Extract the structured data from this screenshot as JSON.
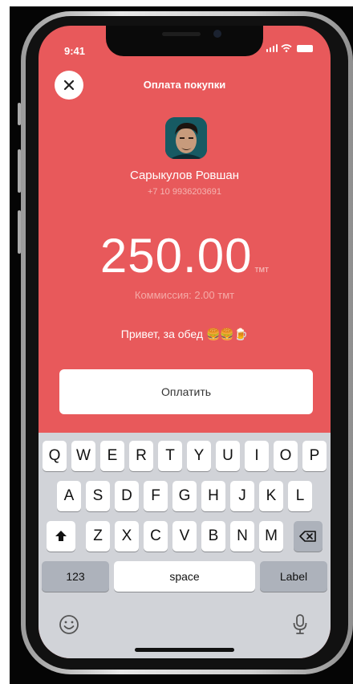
{
  "status_bar": {
    "time": "9:41"
  },
  "header": {
    "title": "Оплата покупки"
  },
  "recipient": {
    "name": "Сарыкулов Ровшан",
    "phone": "+7 10 9936203691"
  },
  "payment": {
    "amount": "250.00",
    "currency": "тмт",
    "commission": "Коммиссия: 2.00 тмт",
    "note": "Привет, за обед 🍔🍔🍺"
  },
  "actions": {
    "pay_label": "Оплатить"
  },
  "keyboard": {
    "row1": [
      "Q",
      "W",
      "E",
      "R",
      "T",
      "Y",
      "U",
      "I",
      "O",
      "P"
    ],
    "row2": [
      "A",
      "S",
      "D",
      "F",
      "G",
      "H",
      "J",
      "K",
      "L"
    ],
    "row3": [
      "Z",
      "X",
      "C",
      "V",
      "B",
      "N",
      "M"
    ],
    "numbers_label": "123",
    "space_label": "space",
    "return_label": "Label"
  },
  "colors": {
    "accent": "#e8595b"
  },
  "icons": [
    "close-icon",
    "shift-icon",
    "backspace-icon",
    "emoji-icon",
    "microphone-icon"
  ]
}
